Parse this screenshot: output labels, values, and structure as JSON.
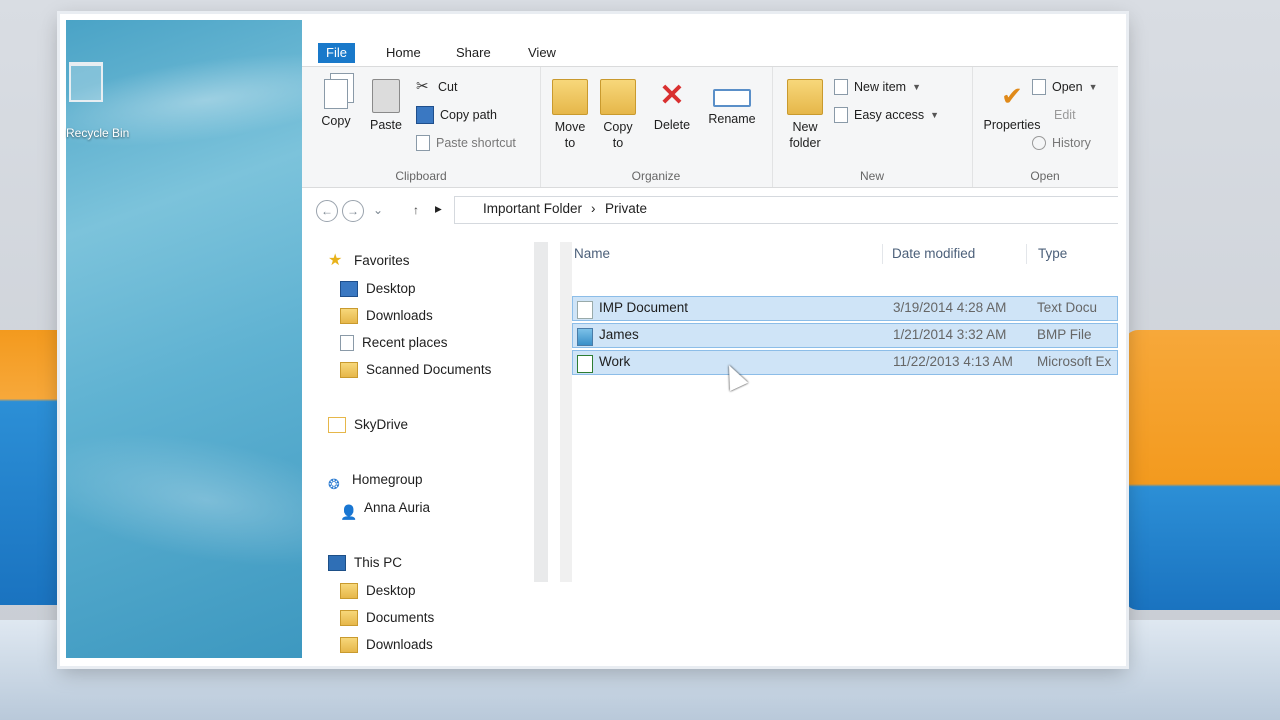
{
  "desktop": {
    "recycle_bin_label": "Recycle Bin"
  },
  "ribbon": {
    "tabs": [
      "File",
      "Home",
      "Share",
      "View"
    ],
    "clipboard": {
      "copy": "Copy",
      "paste": "Paste",
      "cut": "Cut",
      "copy_path": "Copy path",
      "paste_shortcut": "Paste shortcut",
      "label": "Clipboard"
    },
    "organize": {
      "move_to": "Move to",
      "copy_to": "Copy to",
      "delete": "Delete",
      "rename": "Rename",
      "label": "Organize"
    },
    "new": {
      "new_folder": "New folder",
      "new_item": "New item",
      "easy_access": "Easy access",
      "label": "New"
    },
    "open": {
      "properties": "Properties",
      "open": "Open",
      "edit": "Edit",
      "history": "History",
      "label": "Open"
    }
  },
  "address": {
    "crumbs": [
      "Important Folder",
      "Private"
    ]
  },
  "nav": {
    "favorites": "Favorites",
    "favorites_items": [
      "Desktop",
      "Downloads",
      "Recent places",
      "Scanned Documents"
    ],
    "skydrive": "SkyDrive",
    "homegroup": "Homegroup",
    "homegroup_user": "Anna Auria",
    "this_pc": "This PC",
    "pc_items": [
      "Desktop",
      "Documents",
      "Downloads"
    ]
  },
  "files": {
    "columns": {
      "name": "Name",
      "date": "Date modified",
      "type": "Type"
    },
    "rows": [
      {
        "name": "IMP Document",
        "date": "3/19/2014 4:28 AM",
        "type": "Text Docu"
      },
      {
        "name": "James",
        "date": "1/21/2014 3:32 AM",
        "type": "BMP File"
      },
      {
        "name": "Work",
        "date": "11/22/2013 4:13 AM",
        "type": "Microsoft Ex"
      }
    ]
  }
}
